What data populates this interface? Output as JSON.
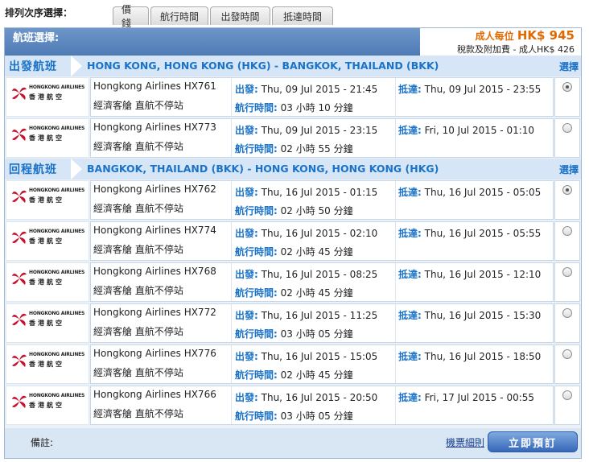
{
  "sort": {
    "label": "排列次序選擇：",
    "tabs": [
      "價錢",
      "航行時間",
      "出發時間",
      "抵達時間"
    ]
  },
  "header": {
    "title": "航班選擇:",
    "price_label": "成人每位 ",
    "price_amount": "HK$ 945",
    "tax_note": "稅款及附加費 - 成人HK$ 426"
  },
  "labels": {
    "depart": "出發:",
    "arrive": "抵達:",
    "duration": "航行時間:",
    "select": "選擇"
  },
  "airline_logo": {
    "name_en": "HONGKONG AIRLINES",
    "name_zh": "香港航空",
    "icon": "bauhinia-logo-icon"
  },
  "outbound": {
    "section": "出發航班",
    "route": "HONG KONG, HONG KONG (HKG) - BANGKOK, THAILAND (BKK)",
    "flights": [
      {
        "airline": "Hongkong Airlines HX761",
        "cabin": "經濟客艙 直航不停站",
        "depart": "Thu, 09 Jul 2015  - 21:45",
        "arrive": "Thu, 09 Jul 2015  - 23:55",
        "duration": "03 小時 10 分鐘",
        "selected": true
      },
      {
        "airline": "Hongkong Airlines HX773",
        "cabin": "經濟客艙 直航不停站",
        "depart": "Thu, 09 Jul 2015  - 23:15",
        "arrive": "Fri, 10 Jul 2015  - 01:10",
        "duration": "02 小時 55 分鐘",
        "selected": false
      }
    ]
  },
  "return": {
    "section": "回程航班",
    "route": "BANGKOK, THAILAND (BKK) - HONG KONG, HONG KONG (HKG)",
    "flights": [
      {
        "airline": "Hongkong Airlines HX762",
        "cabin": "經濟客艙 直航不停站",
        "depart": "Thu, 16 Jul 2015  - 01:15",
        "arrive": "Thu, 16 Jul 2015  - 05:05",
        "duration": "02 小時 50 分鐘",
        "selected": true
      },
      {
        "airline": "Hongkong Airlines HX774",
        "cabin": "經濟客艙 直航不停站",
        "depart": "Thu, 16 Jul 2015  - 02:10",
        "arrive": "Thu, 16 Jul 2015  - 05:55",
        "duration": "02 小時 45 分鐘",
        "selected": false
      },
      {
        "airline": "Hongkong Airlines HX768",
        "cabin": "經濟客艙 直航不停站",
        "depart": "Thu, 16 Jul 2015  - 08:25",
        "arrive": "Thu, 16 Jul 2015  - 12:10",
        "duration": "02 小時 45 分鐘",
        "selected": false
      },
      {
        "airline": "Hongkong Airlines HX772",
        "cabin": "經濟客艙 直航不停站",
        "depart": "Thu, 16 Jul 2015  - 11:25",
        "arrive": "Thu, 16 Jul 2015  - 15:30",
        "duration": "03 小時 05 分鐘",
        "selected": false
      },
      {
        "airline": "Hongkong Airlines HX776",
        "cabin": "經濟客艙 直航不停站",
        "depart": "Thu, 16 Jul 2015  - 15:05",
        "arrive": "Thu, 16 Jul 2015  - 18:50",
        "duration": "02 小時 45 分鐘",
        "selected": false
      },
      {
        "airline": "Hongkong Airlines HX766",
        "cabin": "經濟客艙 直航不停站",
        "depart": "Thu, 16 Jul 2015  - 20:50",
        "arrive": "Fri, 17 Jul 2015  - 00:55",
        "duration": "03 小時 05 分鐘",
        "selected": false
      }
    ]
  },
  "footer": {
    "remark": "備註:",
    "terms": "機票細則",
    "book": "立即預訂"
  },
  "colors": {
    "accent_blue": "#1a73c8",
    "price_orange": "#e06a00",
    "header_blue": "#5a86bf",
    "logo_red": "#c8102e"
  }
}
